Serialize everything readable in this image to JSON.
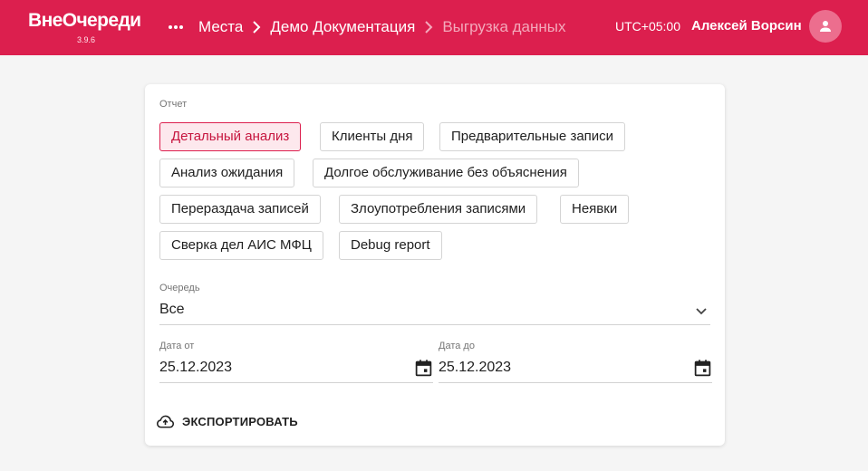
{
  "header": {
    "logo": "ВнеОчереди",
    "version": "3.9.6",
    "breadcrumbs": [
      "Места",
      "Демо Документация",
      "Выгрузка данных"
    ],
    "timezone": "UTC+05:00",
    "user_name": "Алексей Ворсин",
    "bg_color": "#dc1f4e"
  },
  "form": {
    "report_label": "Отчет",
    "reports": [
      {
        "label": "Детальный анализ",
        "active": true
      },
      {
        "label": "Клиенты дня",
        "active": false
      },
      {
        "label": "Предварительные записи",
        "active": false
      },
      {
        "label": "Анализ ожидания",
        "active": false
      },
      {
        "label": "Долгое обслуживание без объяснения",
        "active": false
      },
      {
        "label": "Перераздача записей",
        "active": false
      },
      {
        "label": "Злоупотребления записями",
        "active": false
      },
      {
        "label": "Неявки",
        "active": false
      },
      {
        "label": "Сверка дел АИС МФЦ",
        "active": false
      },
      {
        "label": "Debug report",
        "active": false
      }
    ],
    "queue_label": "Очередь",
    "queue_value": "Все",
    "date_from_label": "Дата от",
    "date_from_value": "25.12.2023",
    "date_to_label": "Дата до",
    "date_to_value": "25.12.2023",
    "export_label": "ЭКСПОРТИРОВАТЬ"
  },
  "icons": [
    "more-horiz-icon",
    "chevron-right-icon",
    "person-icon",
    "chevron-down-icon",
    "calendar-icon",
    "cloud-upload-icon"
  ]
}
